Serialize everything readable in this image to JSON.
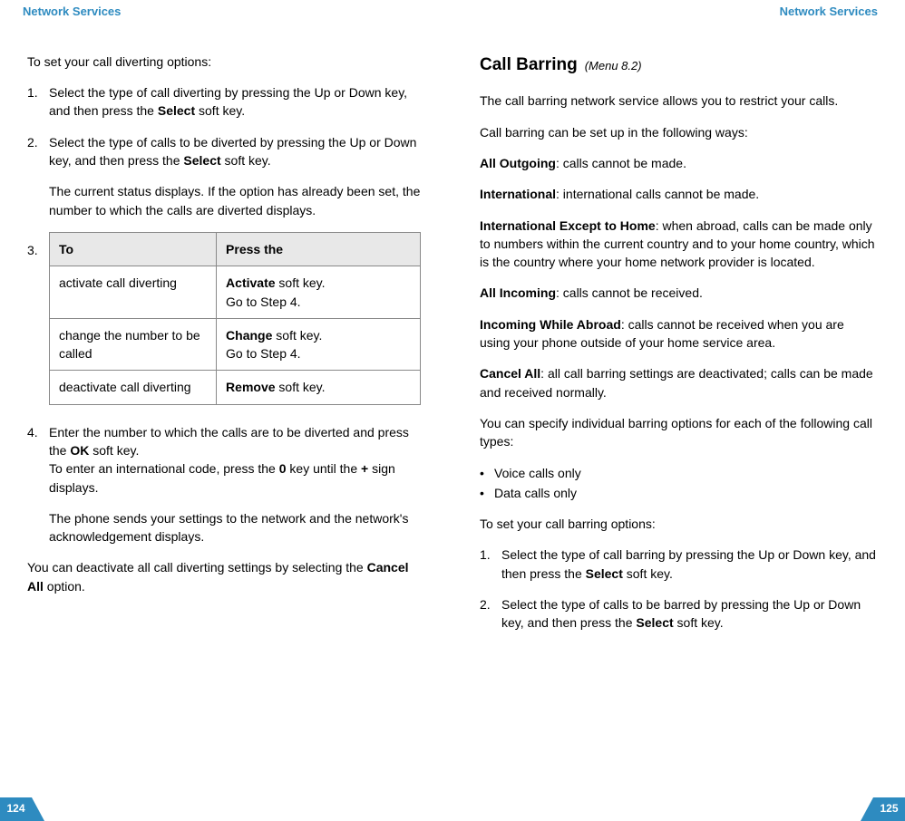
{
  "left": {
    "header": "Network Services",
    "pageNum": "124",
    "intro": "To set your call diverting options:",
    "steps": {
      "s1_marker": "1.",
      "s1_a": "Select the type of call diverting by pressing the Up or Down key, and then press the ",
      "s1_b": "Select",
      "s1_c": " soft key.",
      "s2_marker": "2.",
      "s2_a": "Select the type of calls to be diverted by pressing the Up or Down key, and then press the ",
      "s2_b": "Select",
      "s2_c": " soft key.",
      "s2_sub": "The current status displays. If the option has already been set, the number to which the calls are diverted displays.",
      "s3_marker": "3.",
      "s4_marker": "4.",
      "s4_a": "Enter the number to which the calls are to be diverted and press the ",
      "s4_b": "OK",
      "s4_c": " soft key.",
      "s4_d": "To enter an international code, press the ",
      "s4_e": "0",
      "s4_f": " key until the ",
      "s4_g": "+",
      "s4_h": " sign displays.",
      "s4_sub": "The phone sends your settings to the network and the network's acknowledgement displays."
    },
    "table": {
      "h1": "To",
      "h2": "Press the",
      "r1c1": "activate call diverting",
      "r1c2a": "Activate",
      "r1c2b": " soft key.",
      "r1c2c": "Go to Step 4.",
      "r2c1": "change the number to be called",
      "r2c2a": "Change",
      "r2c2b": " soft key.",
      "r2c2c": "Go to Step 4.",
      "r3c1": "deactivate call diverting",
      "r3c2a": "Remove",
      "r3c2b": " soft key."
    },
    "outro_a": "You can deactivate all call diverting settings by selecting the ",
    "outro_b": "Cancel All",
    "outro_c": " option."
  },
  "right": {
    "header": "Network Services",
    "pageNum": "125",
    "title": "Call Barring",
    "menuRef": "(Menu 8.2)",
    "p1": "The call barring network service allows you to restrict your calls.",
    "p2": "Call barring can be set up in the following ways:",
    "opt": {
      "o1a": "All Outgoing",
      "o1b": ": calls cannot be made.",
      "o2a": "International",
      "o2b": ": international calls cannot be made.",
      "o3a": "International Except to Home",
      "o3b": ": when abroad, calls can be made only to numbers within the current country and to your home country, which is the country where your home network provider is located.",
      "o4a": "All Incoming",
      "o4b": ": calls cannot be received.",
      "o5a": "Incoming While Abroad",
      "o5b": ": calls cannot be received when you are using your phone outside of your home service area.",
      "o6a": "Cancel All",
      "o6b": ": all call barring settings are deactivated; calls can be made and received normally."
    },
    "p3": "You can specify individual barring options for each of the following call types:",
    "bullets": {
      "b1": "Voice calls only",
      "b2": "Data calls only"
    },
    "p4": "To set your call barring options:",
    "steps": {
      "s1_marker": "1.",
      "s1_a": "Select the type of call barring by pressing the Up or Down key, and then press the ",
      "s1_b": "Select",
      "s1_c": " soft key.",
      "s2_marker": "2.",
      "s2_a": "Select the type of calls to be barred by pressing the Up or Down key, and then press the ",
      "s2_b": "Select",
      "s2_c": " soft key."
    }
  }
}
